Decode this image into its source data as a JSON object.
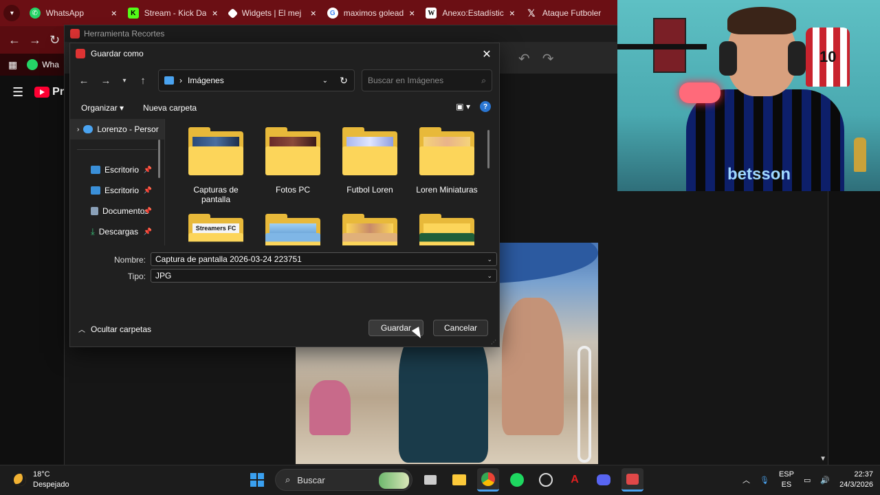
{
  "browser": {
    "tabs": [
      {
        "label": "WhatsApp",
        "icon": "whatsapp-icon",
        "color": "#25d366"
      },
      {
        "label": "Stream - Kick Da",
        "icon": "kick-icon",
        "color": "#53fc18"
      },
      {
        "label": "Widgets | El mej",
        "icon": "widgets-icon",
        "color": "#ffffff"
      },
      {
        "label": "maximos golead",
        "icon": "google-icon",
        "color": "#4285f4"
      },
      {
        "label": "Anexo:Estadístic",
        "icon": "wikipedia-icon",
        "color": "#ffffff"
      },
      {
        "label": "Ataque Futboler",
        "icon": "x-icon",
        "color": "#ffffff"
      }
    ],
    "bookmark_label": "Wha",
    "youtube_logo": "Pre"
  },
  "snipping_tool": {
    "title": "Herramienta Recortes"
  },
  "dialog": {
    "title": "Guardar como",
    "address": "Imágenes",
    "search_placeholder": "Buscar en Imágenes",
    "organize": "Organizar",
    "new_folder": "Nueva carpeta",
    "nav_items": [
      {
        "label": "Lorenzo - Persor",
        "icon": "onedrive-icon"
      },
      {
        "label": "Escritorio",
        "icon": "desktop-icon"
      },
      {
        "label": "Escritorio",
        "icon": "desktop-icon"
      },
      {
        "label": "Documentos",
        "icon": "documents-icon"
      },
      {
        "label": "Descargas",
        "icon": "downloads-icon"
      }
    ],
    "folders": [
      {
        "name": "Capturas de pantalla"
      },
      {
        "name": "Fotos PC"
      },
      {
        "name": "Futbol Loren"
      },
      {
        "name": "Loren Miniaturas"
      },
      {
        "name": ""
      },
      {
        "name": ""
      },
      {
        "name": ""
      },
      {
        "name": ""
      }
    ],
    "folder_thumb_texts": [
      "Streamers FC"
    ],
    "filename_label": "Nombre:",
    "filename_value": "Captura de pantalla 2026-03-24 223751",
    "type_label": "Tipo:",
    "type_value": "JPG",
    "hide_folders": "Ocultar carpetas",
    "save": "Guardar",
    "cancel": "Cancelar"
  },
  "webcam": {
    "jersey_number": "10",
    "shirt_text": "betsson"
  },
  "taskbar": {
    "temperature": "18°C",
    "weather": "Despejado",
    "search": "Buscar",
    "lang_top": "ESP",
    "lang_bottom": "ES",
    "time": "22:37",
    "date": "24/3/2026"
  },
  "colors": {
    "tabbar": "#6b0f14",
    "accent": "#2a76d2",
    "folder": "#fcd55a"
  }
}
